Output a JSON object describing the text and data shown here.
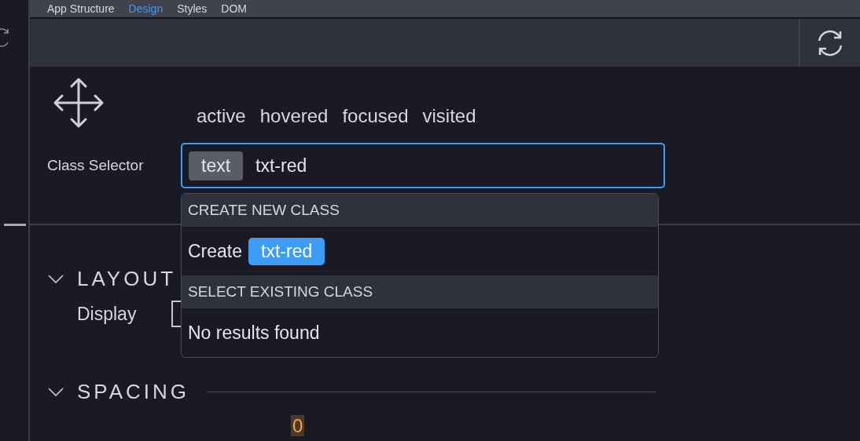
{
  "tabs": [
    {
      "label": "App Structure",
      "selected": false
    },
    {
      "label": "Design",
      "selected": true
    },
    {
      "label": "Styles",
      "selected": false
    },
    {
      "label": "DOM",
      "selected": false
    }
  ],
  "states": [
    "active",
    "hovered",
    "focused",
    "visited"
  ],
  "class_selector": {
    "label": "Class Selector",
    "tags": [
      "text"
    ],
    "value": "txt-red"
  },
  "dropdown": {
    "sections": [
      {
        "header": "CREATE NEW CLASS",
        "kind": "create",
        "prefix": "Create",
        "chip": "txt-red"
      },
      {
        "header": "SELECT EXISTING CLASS",
        "kind": "empty",
        "message": "No results found"
      }
    ]
  },
  "sections": [
    {
      "title": "LAYOUT",
      "expanded": true,
      "fields": [
        {
          "label": "Display"
        }
      ]
    },
    {
      "title": "SPACING",
      "expanded": true,
      "value": "0"
    }
  ]
}
